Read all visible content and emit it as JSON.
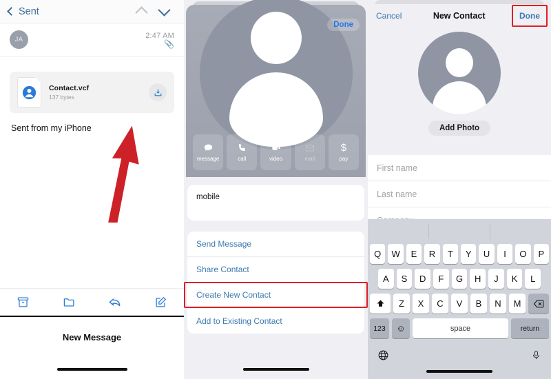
{
  "panel_mail": {
    "nav": {
      "back_label": "Sent",
      "up_icon": "chevron-up-icon",
      "down_icon": "chevron-down-icon"
    },
    "message": {
      "avatar_initials": "JA",
      "time": "2:47 AM",
      "attachment_indicator_icon": "paperclip-icon"
    },
    "attachment": {
      "file_name": "Contact.vcf",
      "file_size": "137 bytes",
      "thumb_icon": "contact-person-icon",
      "download_icon": "download-icon"
    },
    "signature": "Sent from my iPhone",
    "toolbar": [
      {
        "name": "archive-icon",
        "label": "Archive"
      },
      {
        "name": "folder-icon",
        "label": "Move to folder"
      },
      {
        "name": "reply-icon",
        "label": "Reply"
      },
      {
        "name": "compose-icon",
        "label": "Compose"
      }
    ],
    "bottom_sheet_title": "New Message",
    "annotation": {
      "type": "red-arrow",
      "color": "#cc2127"
    }
  },
  "panel_contact_card": {
    "done_label": "Done",
    "avatar_icon": "contact-placeholder-avatar",
    "quick_actions": [
      {
        "icon": "message-icon",
        "label": "message",
        "glyph": "●",
        "disabled": false
      },
      {
        "icon": "phone-icon",
        "label": "call",
        "glyph": "●",
        "disabled": false
      },
      {
        "icon": "video-icon",
        "label": "video",
        "glyph": "●",
        "disabled": false
      },
      {
        "icon": "mail-icon",
        "label": "mail",
        "glyph": "✉",
        "disabled": true
      },
      {
        "icon": "pay-icon",
        "label": "pay",
        "glyph": "$",
        "disabled": false
      }
    ],
    "field_label": "mobile",
    "sheet_options": [
      {
        "label": "Send Message",
        "highlighted": false
      },
      {
        "label": "Share Contact",
        "highlighted": false
      },
      {
        "label": "Create New Contact",
        "highlighted": true
      },
      {
        "label": "Add to Existing Contact",
        "highlighted": false
      }
    ],
    "highlight_color": "#dd1f26"
  },
  "panel_new_contact": {
    "cancel_label": "Cancel",
    "title": "New Contact",
    "done_label": "Done",
    "done_highlighted": true,
    "avatar_icon": "contact-placeholder-avatar",
    "add_photo_label": "Add Photo",
    "fields": [
      {
        "placeholder": "First name",
        "value": ""
      },
      {
        "placeholder": "Last name",
        "value": ""
      },
      {
        "placeholder": "Company",
        "value": ""
      }
    ],
    "keyboard": {
      "row1": [
        "Q",
        "W",
        "E",
        "R",
        "T",
        "Y",
        "U",
        "I",
        "O",
        "P"
      ],
      "row2": [
        "A",
        "S",
        "D",
        "F",
        "G",
        "H",
        "J",
        "K",
        "L"
      ],
      "row3": [
        "Z",
        "X",
        "C",
        "V",
        "B",
        "N",
        "M"
      ],
      "shift_icon": "shift-up-arrow-icon",
      "backspace_icon": "backspace-delete-icon",
      "numbers_label": "123",
      "emoji_icon": "emoji-smiley-icon",
      "space_label": "space",
      "return_label": "return",
      "globe_icon": "globe-language-icon",
      "mic_icon": "microphone-icon"
    }
  },
  "colors": {
    "ios_blue": "#3d7ab0",
    "annotation_red": "#dd1f26",
    "avatar_gray": "#8f95a3",
    "keyboard_bg": "#d1d4db"
  }
}
